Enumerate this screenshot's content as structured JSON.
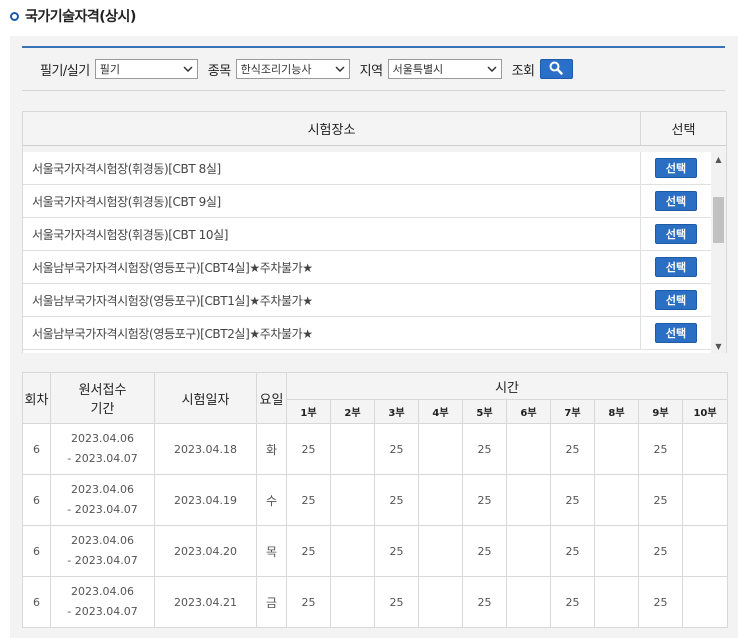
{
  "title": "국가기술자격(상시)",
  "filters": {
    "exam_type_label": "필기/실기",
    "exam_type_value": "필기",
    "item_label": "종목",
    "item_value": "한식조리기능사",
    "region_label": "지역",
    "region_value": "서울특별시",
    "search_label": "조회"
  },
  "venue_table": {
    "header_name": "시험장소",
    "header_select": "선택",
    "rows": [
      {
        "name": "서울국가자격시험장(휘경동)[CBT 8실]",
        "button": "선택"
      },
      {
        "name": "서울국가자격시험장(휘경동)[CBT 9실]",
        "button": "선택"
      },
      {
        "name": "서울국가자격시험장(휘경동)[CBT 10실]",
        "button": "선택"
      },
      {
        "name": "서울남부국가자격시험장(영등포구)[CBT4실]★주차불가★",
        "button": "선택"
      },
      {
        "name": "서울남부국가자격시험장(영등포구)[CBT1실]★주차불가★",
        "button": "선택"
      },
      {
        "name": "서울남부국가자격시험장(영등포구)[CBT2실]★주차불가★",
        "button": "선택"
      }
    ]
  },
  "schedule": {
    "headers": {
      "round": "회차",
      "application_line1": "원서접수",
      "application_line2": "기간",
      "exam_date": "시험일자",
      "weekday": "요일",
      "time": "시간"
    },
    "sessions": [
      "1부",
      "2부",
      "3부",
      "4부",
      "5부",
      "6부",
      "7부",
      "8부",
      "9부",
      "10부"
    ],
    "rows": [
      {
        "round": "6",
        "period_start": "2023.04.06",
        "period_end": "- 2023.04.07",
        "date": "2023.04.18",
        "weekday": "화",
        "slots": [
          "25",
          "",
          "25",
          "",
          "25",
          "",
          "25",
          "",
          "25",
          ""
        ]
      },
      {
        "round": "6",
        "period_start": "2023.04.06",
        "period_end": "- 2023.04.07",
        "date": "2023.04.19",
        "weekday": "수",
        "slots": [
          "25",
          "",
          "25",
          "",
          "25",
          "",
          "25",
          "",
          "25",
          ""
        ]
      },
      {
        "round": "6",
        "period_start": "2023.04.06",
        "period_end": "- 2023.04.07",
        "date": "2023.04.20",
        "weekday": "목",
        "slots": [
          "25",
          "",
          "25",
          "",
          "25",
          "",
          "25",
          "",
          "25",
          ""
        ]
      },
      {
        "round": "6",
        "period_start": "2023.04.06",
        "period_end": "- 2023.04.07",
        "date": "2023.04.21",
        "weekday": "금",
        "slots": [
          "25",
          "",
          "25",
          "",
          "25",
          "",
          "25",
          "",
          "25",
          ""
        ]
      }
    ]
  },
  "icons": {
    "title_bullet": "circle-bullet-icon",
    "search": "search-icon",
    "dropdown": "chevron-down-icon"
  },
  "colors": {
    "accent": "#2b6fc4",
    "panel_bg": "#f3f3f3"
  }
}
